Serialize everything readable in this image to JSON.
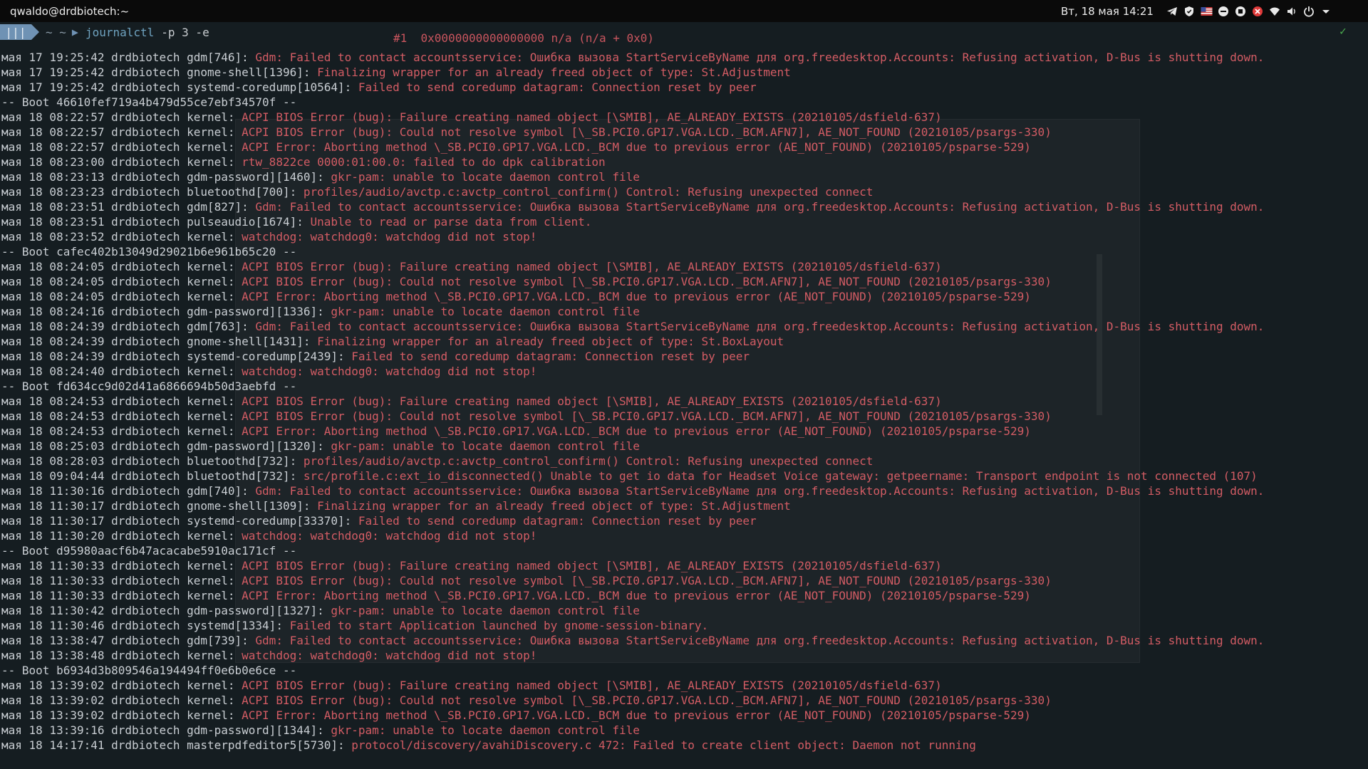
{
  "topbar": {
    "window_title": "qwaldo@drdbiotech:~",
    "clock": "Вт, 18 мая  14:21",
    "tray_icons": [
      "telegram-icon",
      "shield-icon",
      "flag-us-icon",
      "minus-circle-icon",
      "stop-circle-icon",
      "close-circle-icon",
      "wifi-icon",
      "volume-icon",
      "power-icon",
      "chevron-down-icon"
    ]
  },
  "terminal": {
    "prompt": {
      "badge": "|||",
      "path": "~ ~",
      "command": "journalctl",
      "args": "-p 3 -e",
      "status_glyph": "✓"
    },
    "frame_line": "#1  0x0000000000000000 n/a (n/a + 0x0)",
    "lines": [
      {
        "p": "мая 17 19:25:42 drdbiotech gdm[746]:",
        "m": " Gdm: Failed to contact accountsservice: Ошибка вызова StartServiceByName для org.freedesktop.Accounts: Refusing activation, D-Bus is shutting down."
      },
      {
        "p": "мая 17 19:25:42 drdbiotech gnome-shell[1396]:",
        "m": " Finalizing wrapper for an already freed object of type: St.Adjustment"
      },
      {
        "p": "мая 17 19:25:42 drdbiotech systemd-coredump[10564]:",
        "m": " Failed to send coredump datagram: Connection reset by peer"
      },
      {
        "b": "-- Boot 46610fef719a4b479d55ce7ebf34570f --"
      },
      {
        "p": "мая 18 08:22:57 drdbiotech kernel:",
        "m": " ACPI BIOS Error (bug): Failure creating named object [\\SMIB], AE_ALREADY_EXISTS (20210105/dsfield-637)"
      },
      {
        "p": "мая 18 08:22:57 drdbiotech kernel:",
        "m": " ACPI BIOS Error (bug): Could not resolve symbol [\\_SB.PCI0.GP17.VGA.LCD._BCM.AFN7], AE_NOT_FOUND (20210105/psargs-330)"
      },
      {
        "p": "мая 18 08:22:57 drdbiotech kernel:",
        "m": " ACPI Error: Aborting method \\_SB.PCI0.GP17.VGA.LCD._BCM due to previous error (AE_NOT_FOUND) (20210105/psparse-529)"
      },
      {
        "p": "мая 18 08:23:00 drdbiotech kernel:",
        "m": " rtw_8822ce 0000:01:00.0: failed to do dpk calibration"
      },
      {
        "p": "мая 18 08:23:13 drdbiotech gdm-password][1460]:",
        "m": " gkr-pam: unable to locate daemon control file"
      },
      {
        "p": "мая 18 08:23:23 drdbiotech bluetoothd[700]:",
        "m": " profiles/audio/avctp.c:avctp_control_confirm() Control: Refusing unexpected connect"
      },
      {
        "p": "мая 18 08:23:51 drdbiotech gdm[827]:",
        "m": " Gdm: Failed to contact accountsservice: Ошибка вызова StartServiceByName для org.freedesktop.Accounts: Refusing activation, D-Bus is shutting down."
      },
      {
        "p": "мая 18 08:23:51 drdbiotech pulseaudio[1674]:",
        "m": " Unable to read or parse data from client."
      },
      {
        "p": "мая 18 08:23:52 drdbiotech kernel:",
        "m": " watchdog: watchdog0: watchdog did not stop!"
      },
      {
        "b": "-- Boot cafec402b13049d29021b6e961b65c20 --"
      },
      {
        "p": "мая 18 08:24:05 drdbiotech kernel:",
        "m": " ACPI BIOS Error (bug): Failure creating named object [\\SMIB], AE_ALREADY_EXISTS (20210105/dsfield-637)"
      },
      {
        "p": "мая 18 08:24:05 drdbiotech kernel:",
        "m": " ACPI BIOS Error (bug): Could not resolve symbol [\\_SB.PCI0.GP17.VGA.LCD._BCM.AFN7], AE_NOT_FOUND (20210105/psargs-330)"
      },
      {
        "p": "мая 18 08:24:05 drdbiotech kernel:",
        "m": " ACPI Error: Aborting method \\_SB.PCI0.GP17.VGA.LCD._BCM due to previous error (AE_NOT_FOUND) (20210105/psparse-529)"
      },
      {
        "p": "мая 18 08:24:16 drdbiotech gdm-password][1336]:",
        "m": " gkr-pam: unable to locate daemon control file"
      },
      {
        "p": "мая 18 08:24:39 drdbiotech gdm[763]:",
        "m": " Gdm: Failed to contact accountsservice: Ошибка вызова StartServiceByName для org.freedesktop.Accounts: Refusing activation, D-Bus is shutting down."
      },
      {
        "p": "мая 18 08:24:39 drdbiotech gnome-shell[1431]:",
        "m": " Finalizing wrapper for an already freed object of type: St.BoxLayout"
      },
      {
        "p": "мая 18 08:24:39 drdbiotech systemd-coredump[2439]:",
        "m": " Failed to send coredump datagram: Connection reset by peer"
      },
      {
        "p": "мая 18 08:24:40 drdbiotech kernel:",
        "m": " watchdog: watchdog0: watchdog did not stop!"
      },
      {
        "b": "-- Boot fd634cc9d02d41a6866694b50d3aebfd --"
      },
      {
        "p": "мая 18 08:24:53 drdbiotech kernel:",
        "m": " ACPI BIOS Error (bug): Failure creating named object [\\SMIB], AE_ALREADY_EXISTS (20210105/dsfield-637)"
      },
      {
        "p": "мая 18 08:24:53 drdbiotech kernel:",
        "m": " ACPI BIOS Error (bug): Could not resolve symbol [\\_SB.PCI0.GP17.VGA.LCD._BCM.AFN7], AE_NOT_FOUND (20210105/psargs-330)"
      },
      {
        "p": "мая 18 08:24:53 drdbiotech kernel:",
        "m": " ACPI Error: Aborting method \\_SB.PCI0.GP17.VGA.LCD._BCM due to previous error (AE_NOT_FOUND) (20210105/psparse-529)"
      },
      {
        "p": "мая 18 08:25:03 drdbiotech gdm-password][1320]:",
        "m": " gkr-pam: unable to locate daemon control file"
      },
      {
        "p": "мая 18 08:28:03 drdbiotech bluetoothd[732]:",
        "m": " profiles/audio/avctp.c:avctp_control_confirm() Control: Refusing unexpected connect"
      },
      {
        "p": "мая 18 09:04:44 drdbiotech bluetoothd[732]:",
        "m": " src/profile.c:ext_io_disconnected() Unable to get io data for Headset Voice gateway: getpeername: Transport endpoint is not connected (107)"
      },
      {
        "p": "мая 18 11:30:16 drdbiotech gdm[740]:",
        "m": " Gdm: Failed to contact accountsservice: Ошибка вызова StartServiceByName для org.freedesktop.Accounts: Refusing activation, D-Bus is shutting down."
      },
      {
        "p": "мая 18 11:30:17 drdbiotech gnome-shell[1309]:",
        "m": " Finalizing wrapper for an already freed object of type: St.Adjustment"
      },
      {
        "p": "мая 18 11:30:17 drdbiotech systemd-coredump[33370]:",
        "m": " Failed to send coredump datagram: Connection reset by peer"
      },
      {
        "p": "мая 18 11:30:20 drdbiotech kernel:",
        "m": " watchdog: watchdog0: watchdog did not stop!"
      },
      {
        "b": "-- Boot d95980aacf6b47acacabe5910ac171cf --"
      },
      {
        "p": "мая 18 11:30:33 drdbiotech kernel:",
        "m": " ACPI BIOS Error (bug): Failure creating named object [\\SMIB], AE_ALREADY_EXISTS (20210105/dsfield-637)"
      },
      {
        "p": "мая 18 11:30:33 drdbiotech kernel:",
        "m": " ACPI BIOS Error (bug): Could not resolve symbol [\\_SB.PCI0.GP17.VGA.LCD._BCM.AFN7], AE_NOT_FOUND (20210105/psargs-330)"
      },
      {
        "p": "мая 18 11:30:33 drdbiotech kernel:",
        "m": " ACPI Error: Aborting method \\_SB.PCI0.GP17.VGA.LCD._BCM due to previous error (AE_NOT_FOUND) (20210105/psparse-529)"
      },
      {
        "p": "мая 18 11:30:42 drdbiotech gdm-password][1327]:",
        "m": " gkr-pam: unable to locate daemon control file"
      },
      {
        "p": "мая 18 11:30:46 drdbiotech systemd[1334]:",
        "m": " Failed to start Application launched by gnome-session-binary."
      },
      {
        "p": "мая 18 13:38:47 drdbiotech gdm[739]:",
        "m": " Gdm: Failed to contact accountsservice: Ошибка вызова StartServiceByName для org.freedesktop.Accounts: Refusing activation, D-Bus is shutting down."
      },
      {
        "p": "мая 18 13:38:48 drdbiotech kernel:",
        "m": " watchdog: watchdog0: watchdog did not stop!"
      },
      {
        "b": "-- Boot b6934d3b809546a194494ff0e6b0e6ce --"
      },
      {
        "p": "мая 18 13:39:02 drdbiotech kernel:",
        "m": " ACPI BIOS Error (bug): Failure creating named object [\\SMIB], AE_ALREADY_EXISTS (20210105/dsfield-637)"
      },
      {
        "p": "мая 18 13:39:02 drdbiotech kernel:",
        "m": " ACPI BIOS Error (bug): Could not resolve symbol [\\_SB.PCI0.GP17.VGA.LCD._BCM.AFN7], AE_NOT_FOUND (20210105/psargs-330)"
      },
      {
        "p": "мая 18 13:39:02 drdbiotech kernel:",
        "m": " ACPI Error: Aborting method \\_SB.PCI0.GP17.VGA.LCD._BCM due to previous error (AE_NOT_FOUND) (20210105/psparse-529)"
      },
      {
        "p": "мая 18 13:39:16 drdbiotech gdm-password][1344]:",
        "m": " gkr-pam: unable to locate daemon control file"
      },
      {
        "p": "мая 18 14:17:41 drdbiotech masterpdfeditor5[5730]:",
        "m": " protocol/discovery/avahiDiscovery.c 472: Failed to create client object: Daemon not running"
      }
    ]
  },
  "colors": {
    "topbar_bg": "#0a0a0a",
    "terminal_bg": "#151d21",
    "error_text": "#d35c64",
    "prefix_text": "#c9ced3",
    "accent": "#6f92b4",
    "ok": "#4caf50"
  }
}
